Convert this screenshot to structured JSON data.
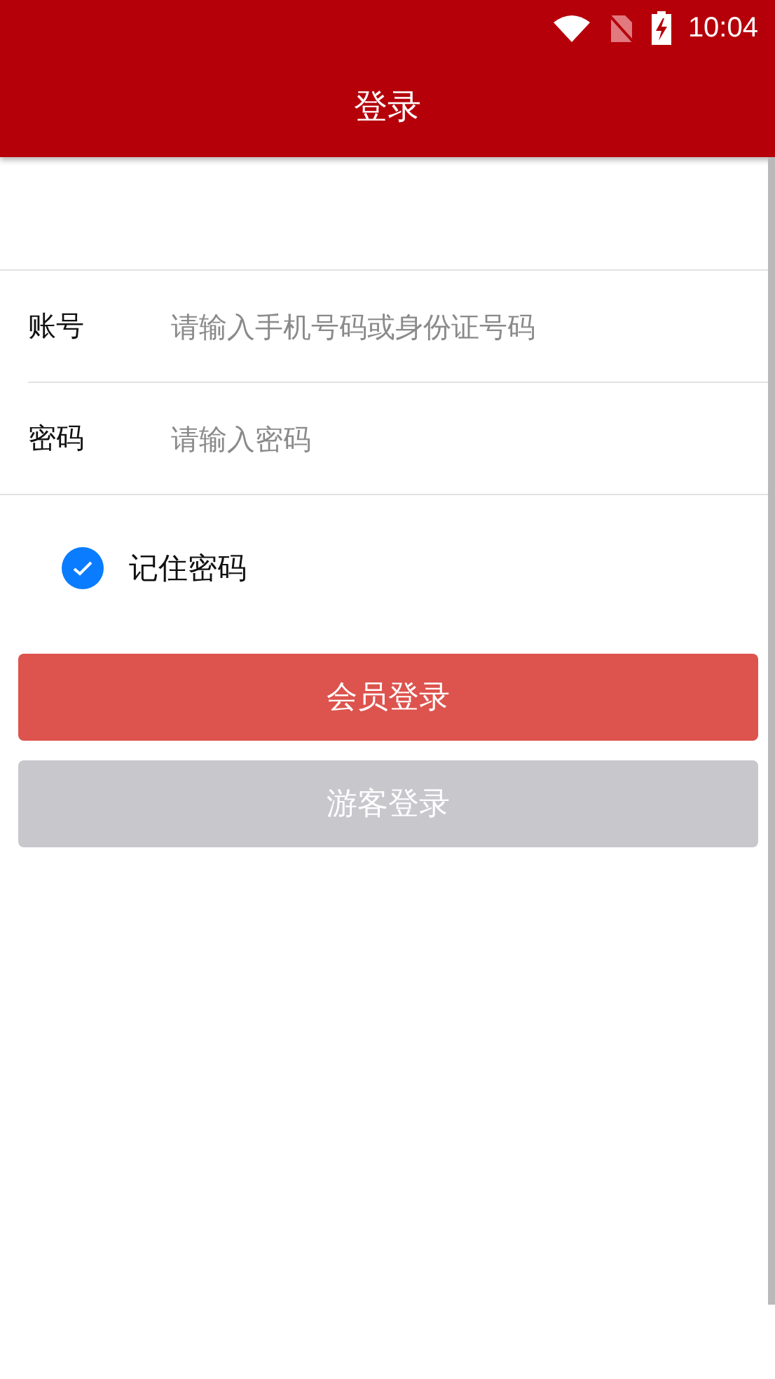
{
  "status_bar": {
    "time": "10:04"
  },
  "header": {
    "title": "登录"
  },
  "fields": [
    {
      "label": "账号",
      "placeholder": "请输入手机号码或身份证号码"
    },
    {
      "label": "密码",
      "placeholder": "请输入密码"
    }
  ],
  "remember": {
    "label": "记住密码",
    "checked": true
  },
  "buttons": [
    {
      "label": "会员登录",
      "kind": "primary"
    },
    {
      "label": "游客登录",
      "kind": "secondary"
    }
  ]
}
